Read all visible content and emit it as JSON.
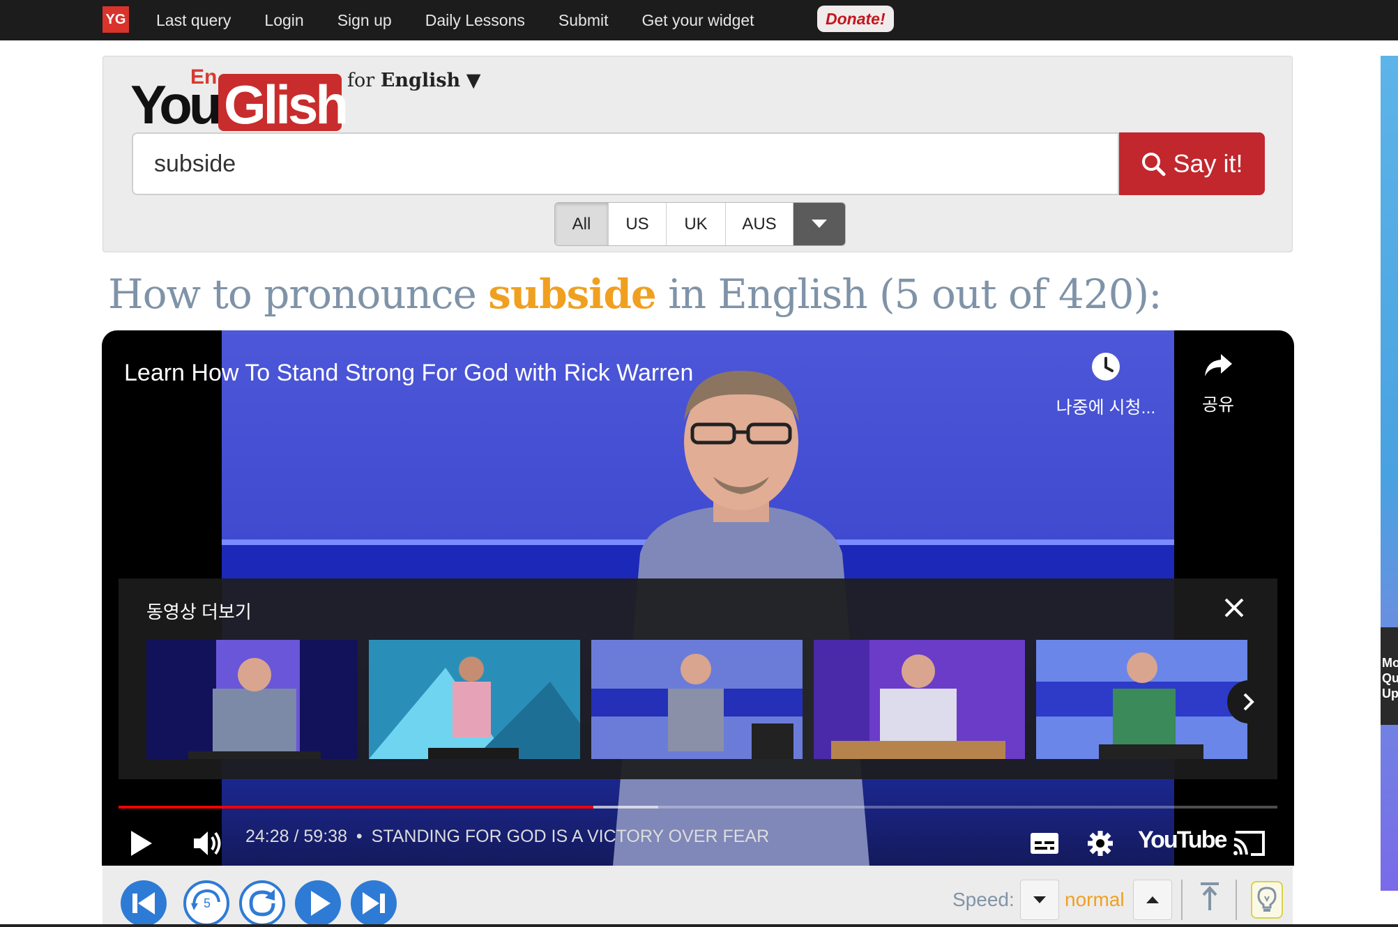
{
  "nav": {
    "badge": "YG",
    "items": [
      "Last query",
      "Login",
      "Sign up",
      "Daily Lessons",
      "Submit",
      "Get your widget"
    ],
    "donate": "Donate!"
  },
  "logo": {
    "en": "En",
    "you": "You",
    "glish": "Glish"
  },
  "language_selector": {
    "prefix": "for",
    "language": "English",
    "arrow": "▼"
  },
  "search": {
    "value": "subside",
    "button_label": "Say it!"
  },
  "accents": {
    "options": [
      "All",
      "US",
      "UK",
      "AUS"
    ],
    "selected": "All"
  },
  "heading": {
    "before": "How to pronounce ",
    "word": "subside",
    "after": " in English (5 out of 420):"
  },
  "video": {
    "title": "Learn How To Stand Strong For God with Rick Warren",
    "watch_later_label": "나중에 시청...",
    "share_label": "공유",
    "more_videos_label": "동영상 더보기",
    "current_time": "24:28",
    "duration": "59:38",
    "separator": "•",
    "chapter": "STANDING FOR GOD IS A VICTORY OVER FEAR",
    "played_fraction": 0.41,
    "buffered_fraction": 0.466,
    "brand": "YouTube"
  },
  "controls": {
    "speed_label": "Speed:",
    "speed_value": "normal",
    "rewind_seconds": "5"
  },
  "colors": {
    "accent_red": "#c1272d",
    "heading": "#7f93a8",
    "highlight": "#f0a020",
    "progress": "#ff0000"
  },
  "side_text": [
    "Mo",
    "Qu",
    "Up"
  ]
}
